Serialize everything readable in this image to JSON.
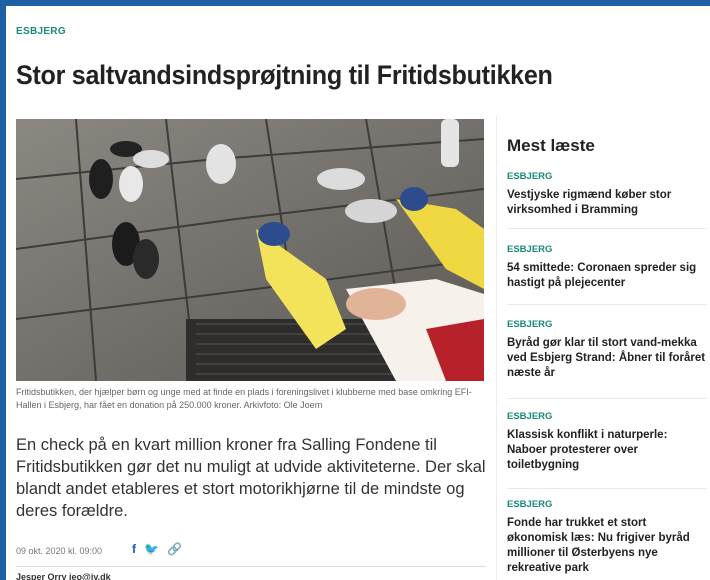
{
  "article": {
    "section": "ESBJERG",
    "headline": "Stor saltvandsindsprøjtning til Fritidsbutikken",
    "caption": "Fritidsbutikken, der hjælper børn og unge med at finde en plads i foreningslivet i klubberne med base omkring EFI-Hallen i Esbjerg, har fået en donation på 250.000 kroner. Arkivfoto: Ole Joern",
    "lead": "En check på en kvart million kroner fra Salling Fondene til Fritidsbutikken gør det nu muligt at udvide aktiviteterne. Der skal blandt andet etableres et stort motorikhjørne til de mindste og deres forældre.",
    "date": "09 okt. 2020 kl. 09:00",
    "author": "Jesper Orry jeo@jv.dk",
    "share": {
      "facebook": "f",
      "twitter": "🐦",
      "link": "🔗"
    }
  },
  "most_read": {
    "title": "Mest læste",
    "items": [
      {
        "tag": "ESBJERG",
        "title": "Vestjyske rigmænd køber stor virksomhed i Bramming"
      },
      {
        "tag": "ESBJERG",
        "title": "54 smittede: Coronaen spreder sig hastigt på plejecenter"
      },
      {
        "tag": "ESBJERG",
        "title": "Byråd gør klar til stort vand-mekka ved Esbjerg Strand: Åbner til foråret næste år"
      },
      {
        "tag": "ESBJERG",
        "title": "Klassisk konflikt i naturperle: Naboer protesterer over toiletbygning"
      },
      {
        "tag": "ESBJERG",
        "title": "Fonde har trukket et stort økonomisk læs: Nu frigiver byråd millioner til Østerbyens nye rekreative park"
      }
    ]
  },
  "colors": {
    "accent": "#1a8a7a",
    "frame": "#1f5fa3"
  }
}
